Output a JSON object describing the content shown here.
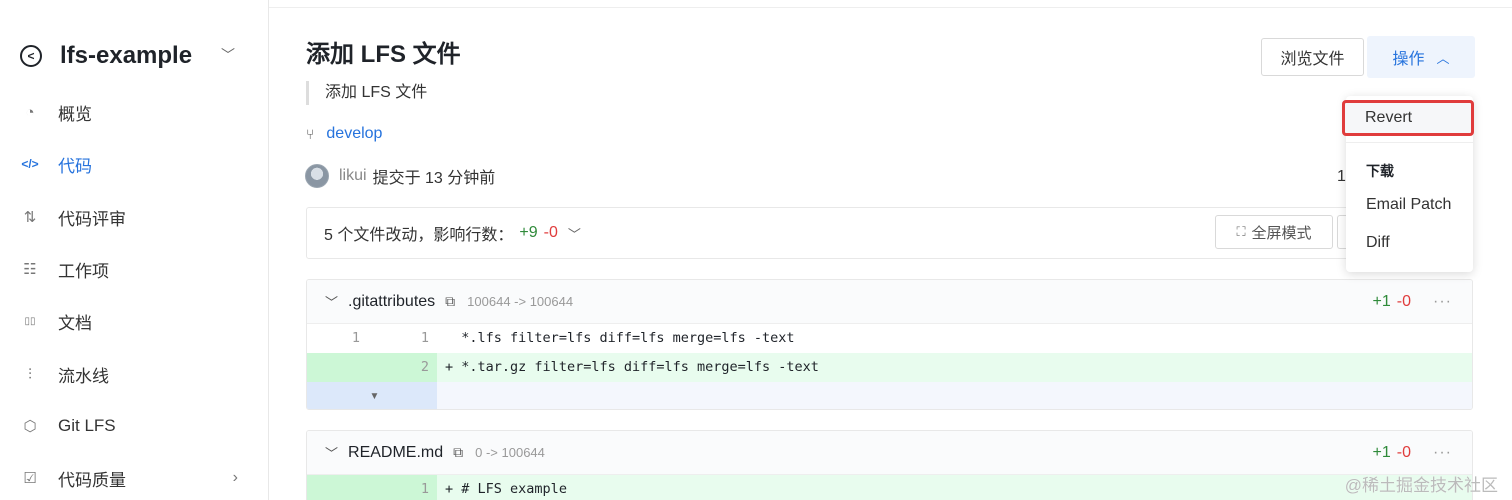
{
  "sidebar": {
    "repo_name": "lfs-example",
    "items": [
      {
        "label": "概览",
        "icon": "dashboard-icon",
        "glyph": "◔"
      },
      {
        "label": "代码",
        "icon": "code-icon",
        "glyph": "</>"
      },
      {
        "label": "代码评审",
        "icon": "merge-request-icon",
        "glyph": "⇅"
      },
      {
        "label": "工作项",
        "icon": "work-items-icon",
        "glyph": "☷"
      },
      {
        "label": "文档",
        "icon": "book-icon",
        "glyph": "▯▯"
      },
      {
        "label": "流水线",
        "icon": "pipeline-icon",
        "glyph": "⫶"
      },
      {
        "label": "Git LFS",
        "icon": "cube-icon",
        "glyph": "⬡"
      },
      {
        "label": "代码质量",
        "icon": "quality-icon",
        "glyph": "☑"
      }
    ]
  },
  "commit": {
    "title": "添加 LFS 文件",
    "message": "添加 LFS 文件",
    "branch": "develop",
    "author": "likui",
    "time_text": "提交于 13 分钟前",
    "right_value": "1"
  },
  "actions": {
    "browse_label": "浏览文件",
    "ops_label": "操作",
    "menu": {
      "revert": "Revert",
      "download_heading": "下载",
      "email_patch": "Email Patch",
      "diff": "Diff"
    }
  },
  "summary": {
    "text": "5 个文件改动，影响行数：",
    "additions": "+9",
    "deletions": "-0",
    "fullscreen_label": "全屏模式"
  },
  "files": [
    {
      "name": ".gitattributes",
      "mode": "100644 -> 100644",
      "additions": "+1",
      "deletions": "-0",
      "lines": [
        {
          "old": "1",
          "new": "1",
          "sign": " ",
          "code": "*.lfs filter=lfs diff=lfs merge=lfs -text"
        },
        {
          "old": "",
          "new": "2",
          "sign": "+",
          "code": "*.tar.gz filter=lfs diff=lfs merge=lfs -text"
        }
      ]
    },
    {
      "name": "README.md",
      "mode": "0 -> 100644",
      "additions": "+1",
      "deletions": "-0",
      "lines": [
        {
          "old": "",
          "new": "1",
          "sign": "+",
          "code": "# LFS example"
        }
      ]
    }
  ],
  "watermark": "@稀土掘金技术社区"
}
